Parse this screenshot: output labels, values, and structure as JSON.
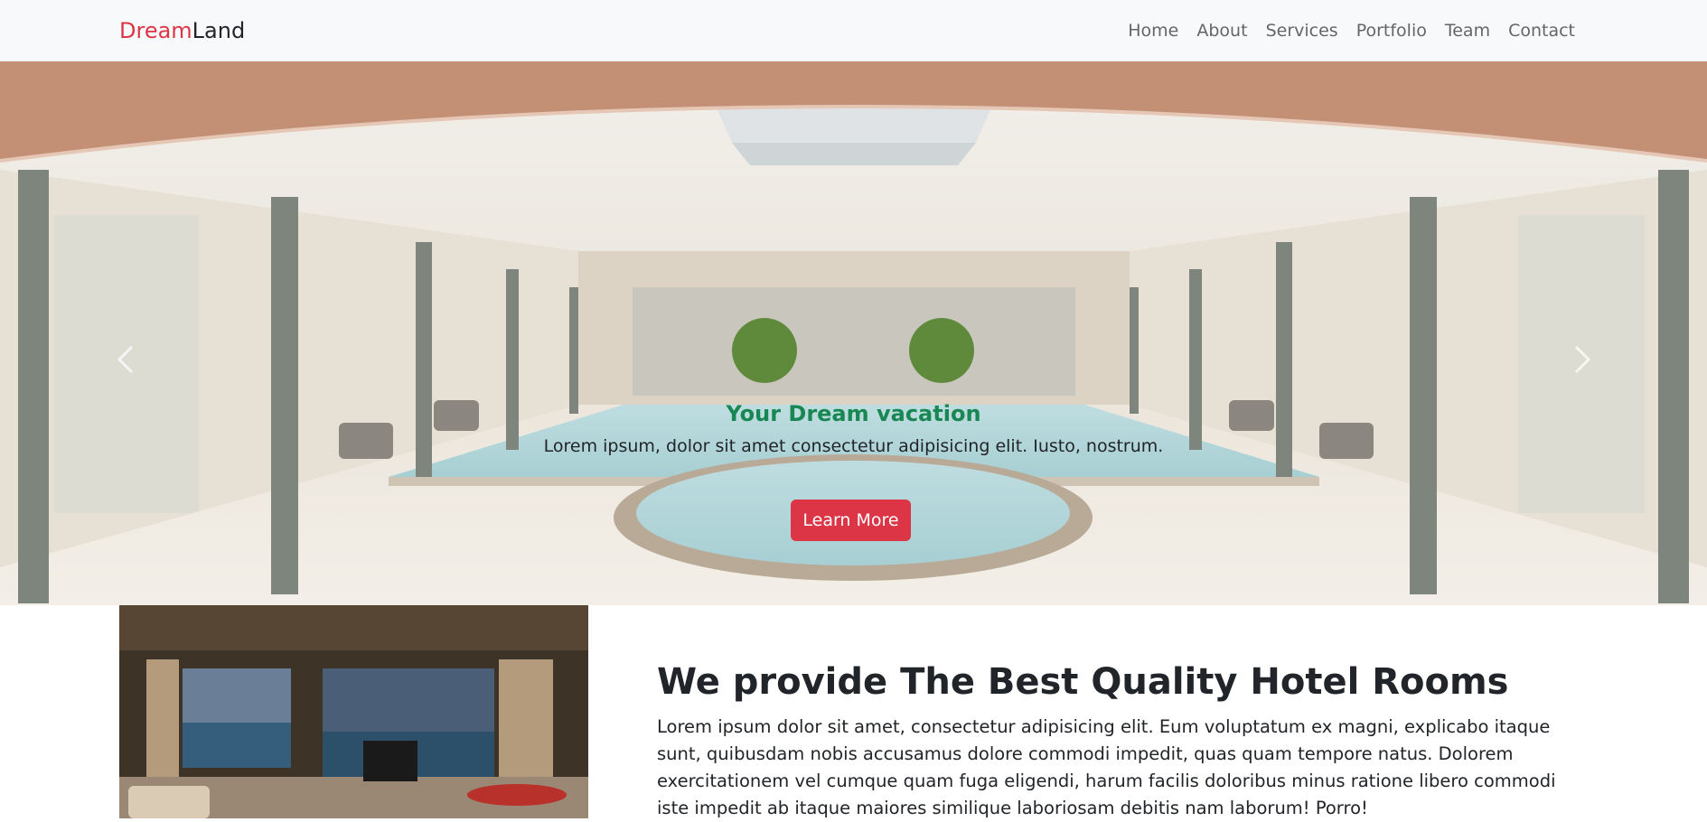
{
  "navbar": {
    "brand_part1": "Dream",
    "brand_part2": "Land",
    "links": [
      "Home",
      "About",
      "Services",
      "Portfolio",
      "Team",
      "Contact"
    ]
  },
  "hero": {
    "title": "Your Dream vacation",
    "text": "Lorem ipsum, dolor sit amet consectetur adipisicing elit. Iusto, nostrum.",
    "button_label": "Learn More",
    "prev_icon": "chevron-left-icon",
    "next_icon": "chevron-right-icon"
  },
  "about": {
    "title": "We provide The Best Quality Hotel Rooms",
    "text": "Lorem ipsum dolor sit amet, consectetur adipisicing elit. Eum voluptatum ex magni, explicabo itaque sunt, quibusdam nobis accusamus dolore commodi impedit, quas quam tempore natus. Dolorem exercitationem vel cumque quam fuga eligendi, harum facilis doloribus minus ratione libero commodi iste impedit ab itaque maiores similique laboriosam debitis nam laborum! Porro!"
  },
  "colors": {
    "brand_red": "#dc3545",
    "title_green": "#198754",
    "navbar_bg": "#f8f9fa"
  }
}
